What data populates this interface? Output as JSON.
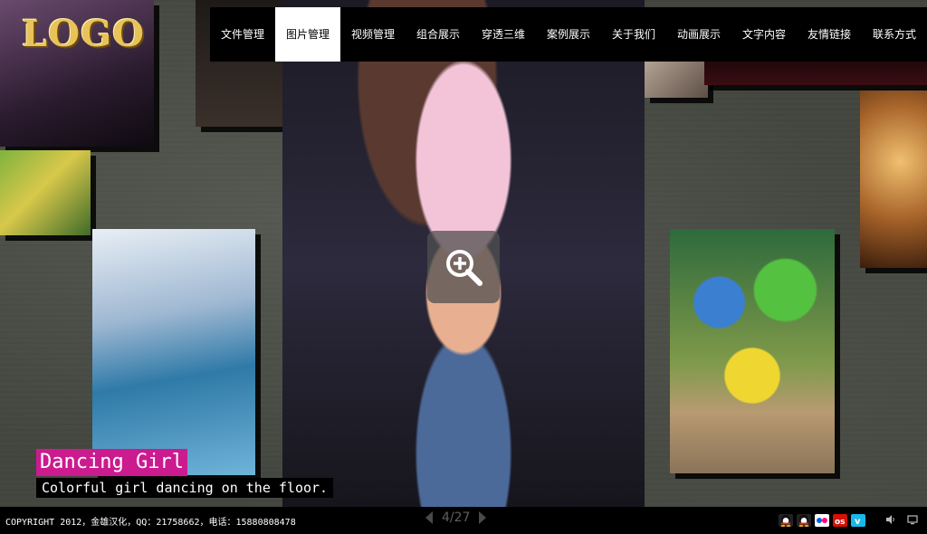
{
  "logo": {
    "text": "LOGO"
  },
  "nav": {
    "items": [
      "文件管理",
      "图片管理",
      "视频管理",
      "组合展示",
      "穿透三维",
      "案例展示",
      "关于我们",
      "动画展示",
      "文字内容",
      "友情链接",
      "联系方式"
    ],
    "active_index": 1
  },
  "caption": {
    "title": "Dancing Girl",
    "subtitle": "Colorful girl dancing on the floor."
  },
  "footer": {
    "copyright": "COPYRIGHT 2012，金雄汉化，QQ：21758662，电话：15880808478",
    "pager": "4/27",
    "social_icons": [
      "qq-icon",
      "qq-icon",
      "flickr-icon",
      "lastfm-icon",
      "vimeo-icon"
    ],
    "social_colors": [
      "#d4301c",
      "#d4301c",
      "#ffffff",
      "#d51007",
      "#1ab7ea"
    ],
    "controls": [
      "volume-icon",
      "fullscreen-icon"
    ]
  },
  "colors": {
    "accent": "#cc1a8f",
    "nav_active_bg": "#ffffff",
    "nav_bg": "#000000"
  }
}
